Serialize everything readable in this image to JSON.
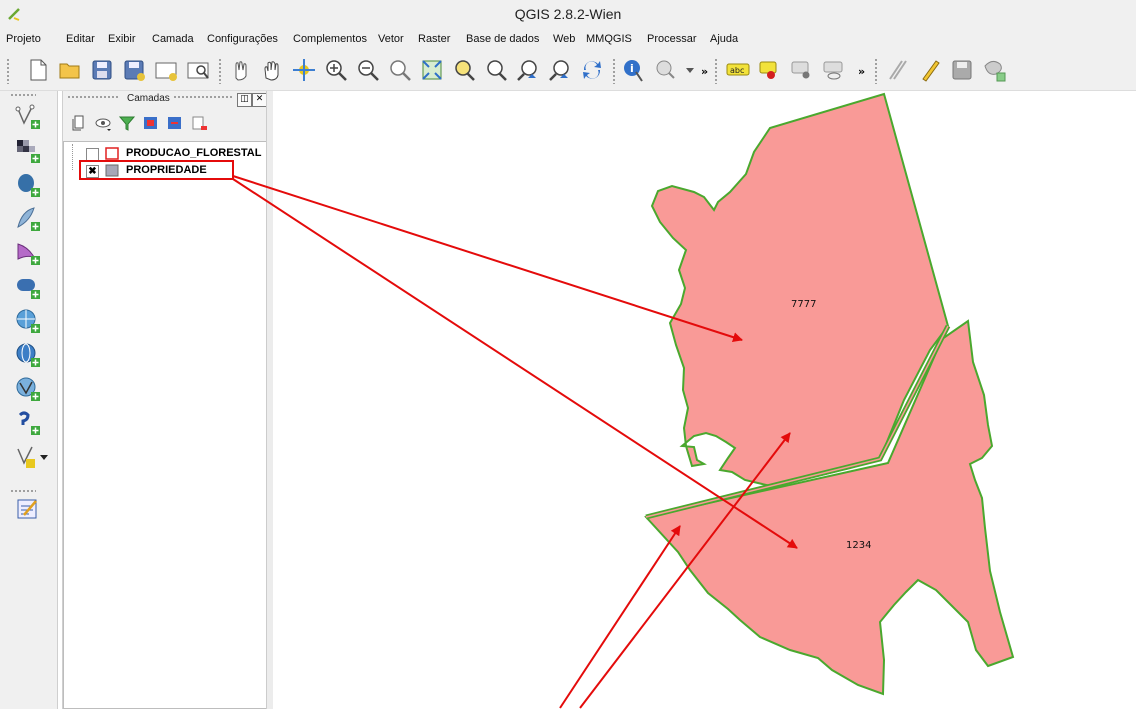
{
  "window": {
    "title": "QGIS 2.8.2-Wien"
  },
  "menu": [
    "Projeto",
    "Editar",
    "Exibir",
    "Camada",
    "Configurações",
    "Complementos",
    "Vetor",
    "Raster",
    "Base de dados",
    "Web",
    "MMQGIS",
    "Processar",
    "Ajuda"
  ],
  "toolbar": {
    "overflow1": "»",
    "overflow2": "»",
    "label_tool": "abc"
  },
  "layers_panel": {
    "title": "Camadas",
    "layers": [
      {
        "name": "PRODUCAO_FLORESTAL",
        "checked": false,
        "symbol_fill": "#ffffff",
        "symbol_stroke": "#e02020"
      },
      {
        "name": "PROPRIEDADE",
        "checked": true,
        "check_mark": "✖",
        "symbol_fill": "#a7a7b7",
        "symbol_stroke": "#6a6a6a"
      }
    ]
  },
  "map": {
    "features": [
      {
        "label": "7777",
        "fill": "#f99a97",
        "stroke": "#4aa82e"
      },
      {
        "label": "1234",
        "fill": "#f99a97",
        "stroke": "#4aa82e"
      }
    ],
    "annotation_color": "#e40b0b"
  }
}
